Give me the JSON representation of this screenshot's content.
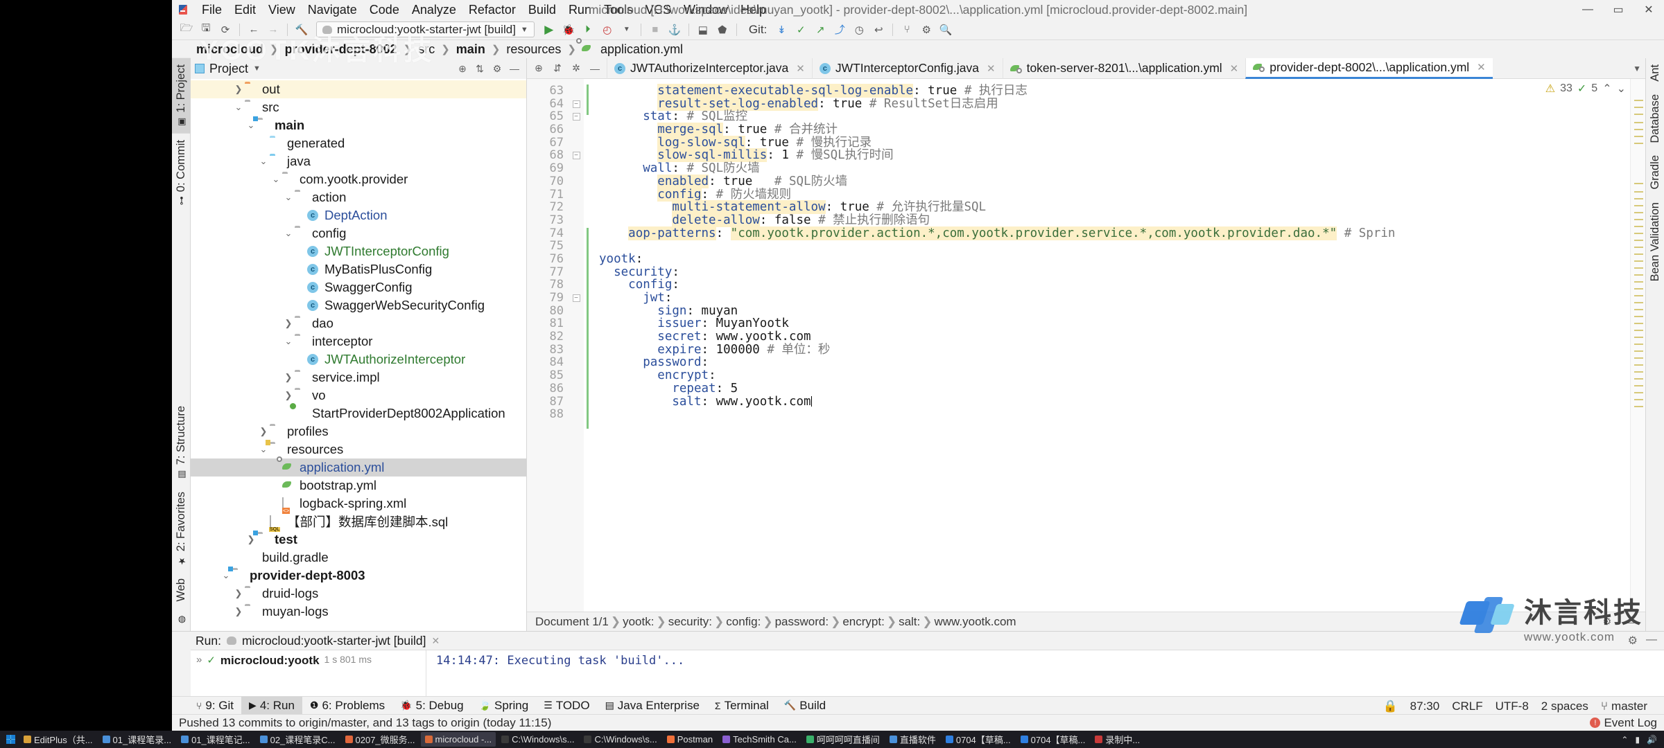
{
  "window": {
    "title": "microcloud [H:\\workspace\\idea\\muyan_yootk] - provider-dept-8002\\...\\application.yml [microcloud.provider-dept-8002.main]",
    "minimize": "—",
    "maximize": "▭",
    "close": "✕"
  },
  "menu": [
    "File",
    "Edit",
    "View",
    "Navigate",
    "Code",
    "Analyze",
    "Refactor",
    "Build",
    "Run",
    "Tools",
    "VCS",
    "Window",
    "Help"
  ],
  "toolbar": {
    "run_config": "microcloud:yootk-starter-jwt [build]",
    "git_label": "Git:",
    "icons": [
      "open-folder-icon",
      "save-icon",
      "sync-icon",
      "back-arrow-icon",
      "forward-arrow-icon",
      "build-hammer-icon",
      "run-icon",
      "debug-icon",
      "run-coverage-icon",
      "profile-icon",
      "stop-icon",
      "settings-icon",
      "search-everywhere-icon"
    ]
  },
  "navbar": {
    "crumbs": [
      "microcloud",
      "provider-dept-8002",
      "src",
      "main",
      "resources",
      "application.yml"
    ]
  },
  "left_stripe": [
    {
      "label": "1: Project",
      "active": true
    },
    {
      "label": "0: Commit",
      "active": false
    }
  ],
  "left_stripe_bottom": [
    {
      "label": "7: Structure"
    },
    {
      "label": "2: Favorites"
    },
    {
      "label": "Web"
    }
  ],
  "right_stripe": [
    {
      "label": "Ant"
    },
    {
      "label": "Database"
    },
    {
      "label": "Gradle"
    },
    {
      "label": "Bean Validation"
    }
  ],
  "project": {
    "panel_title": "Project",
    "tree": [
      {
        "depth": 3,
        "arrow": "collapsed",
        "icon": "folder-orange",
        "label": "out",
        "style": "",
        "row": "hl"
      },
      {
        "depth": 3,
        "arrow": "expanded",
        "icon": "folder-gray",
        "label": "src",
        "style": ""
      },
      {
        "depth": 4,
        "arrow": "expanded",
        "icon": "folder-module",
        "label": "main",
        "style": "bold"
      },
      {
        "depth": 5,
        "arrow": "none",
        "icon": "folder-generated",
        "label": "generated",
        "style": ""
      },
      {
        "depth": 5,
        "arrow": "expanded",
        "icon": "folder-blue",
        "label": "java",
        "style": ""
      },
      {
        "depth": 6,
        "arrow": "expanded",
        "icon": "package",
        "label": "com.yootk.provider",
        "style": ""
      },
      {
        "depth": 7,
        "arrow": "expanded",
        "icon": "package",
        "label": "action",
        "style": ""
      },
      {
        "depth": 8,
        "arrow": "none",
        "icon": "class",
        "label": "DeptAction",
        "style": "link"
      },
      {
        "depth": 7,
        "arrow": "expanded",
        "icon": "package",
        "label": "config",
        "style": ""
      },
      {
        "depth": 8,
        "arrow": "none",
        "icon": "class",
        "label": "JWTInterceptorConfig",
        "style": "green"
      },
      {
        "depth": 8,
        "arrow": "none",
        "icon": "class",
        "label": "MyBatisPlusConfig",
        "style": ""
      },
      {
        "depth": 8,
        "arrow": "none",
        "icon": "class",
        "label": "SwaggerConfig",
        "style": ""
      },
      {
        "depth": 8,
        "arrow": "none",
        "icon": "class",
        "label": "SwaggerWebSecurityConfig",
        "style": ""
      },
      {
        "depth": 7,
        "arrow": "collapsed",
        "icon": "package",
        "label": "dao",
        "style": ""
      },
      {
        "depth": 7,
        "arrow": "expanded",
        "icon": "package",
        "label": "interceptor",
        "style": ""
      },
      {
        "depth": 8,
        "arrow": "none",
        "icon": "class",
        "label": "JWTAuthorizeInterceptor",
        "style": "green"
      },
      {
        "depth": 7,
        "arrow": "collapsed",
        "icon": "package",
        "label": "service.impl",
        "style": ""
      },
      {
        "depth": 7,
        "arrow": "collapsed",
        "icon": "package",
        "label": "vo",
        "style": ""
      },
      {
        "depth": 7,
        "arrow": "none",
        "icon": "spring-class",
        "label": "StartProviderDept8002Application",
        "style": ""
      },
      {
        "depth": 5,
        "arrow": "collapsed",
        "icon": "folder-gray",
        "label": "profiles",
        "style": ""
      },
      {
        "depth": 5,
        "arrow": "expanded",
        "icon": "folder-resources",
        "label": "resources",
        "style": ""
      },
      {
        "depth": 6,
        "arrow": "none",
        "icon": "yaml",
        "label": "application.yml",
        "style": "link",
        "row": "sel"
      },
      {
        "depth": 6,
        "arrow": "none",
        "icon": "yaml-plain",
        "label": "bootstrap.yml",
        "style": ""
      },
      {
        "depth": 6,
        "arrow": "none",
        "icon": "xml",
        "label": "logback-spring.xml",
        "style": ""
      },
      {
        "depth": 5,
        "arrow": "none",
        "icon": "sql",
        "label": "【部门】数据库创建脚本.sql",
        "style": ""
      },
      {
        "depth": 4,
        "arrow": "collapsed",
        "icon": "folder-module",
        "label": "test",
        "style": "bold"
      },
      {
        "depth": 3,
        "arrow": "none",
        "icon": "gradle",
        "label": "build.gradle",
        "style": ""
      },
      {
        "depth": 2,
        "arrow": "expanded",
        "icon": "folder-module",
        "label": "provider-dept-8003",
        "style": "bold"
      },
      {
        "depth": 3,
        "arrow": "collapsed",
        "icon": "folder-gray",
        "label": "druid-logs",
        "style": ""
      },
      {
        "depth": 3,
        "arrow": "collapsed",
        "icon": "folder-gray",
        "label": "muyan-logs",
        "style": ""
      }
    ]
  },
  "editor": {
    "tabs": [
      {
        "label": "JWTAuthorizeInterceptor.java",
        "icon": "class-icon",
        "active": false
      },
      {
        "label": "JWTInterceptorConfig.java",
        "icon": "class-icon",
        "active": false
      },
      {
        "label": "token-server-8201\\...\\application.yml",
        "icon": "yaml-icon",
        "active": false
      },
      {
        "label": "provider-dept-8002\\...\\application.yml",
        "icon": "yaml-icon",
        "active": true
      }
    ],
    "inspection": {
      "warnings": "33",
      "checks": "5",
      "warn_icon": "warning-triangle-icon",
      "ok_icon": "check-icon"
    },
    "first_line_number": 63,
    "lines": [
      {
        "n": 63,
        "indent": 8,
        "tokens": [
          {
            "t": "statement-executable-sql-log-enable",
            "c": "k",
            "hl": true
          },
          {
            "t": ": ",
            "c": "v"
          },
          {
            "t": "true",
            "c": "v"
          },
          {
            "t": " # 执行日志",
            "c": "cm"
          }
        ]
      },
      {
        "n": 64,
        "indent": 8,
        "fold": "minus",
        "tokens": [
          {
            "t": "result-set-log-enabled",
            "c": "k",
            "hl": true
          },
          {
            "t": ": ",
            "c": "v"
          },
          {
            "t": "true",
            "c": "v"
          },
          {
            "t": " # ResultSet日志启用",
            "c": "cm"
          }
        ]
      },
      {
        "n": 65,
        "indent": 6,
        "fold": "minus",
        "tokens": [
          {
            "t": "stat",
            "c": "k"
          },
          {
            "t": ": ",
            "c": "v"
          },
          {
            "t": "# SQL监控",
            "c": "cm"
          }
        ]
      },
      {
        "n": 66,
        "indent": 8,
        "tokens": [
          {
            "t": "merge-sql",
            "c": "k",
            "hl": true
          },
          {
            "t": ": ",
            "c": "v"
          },
          {
            "t": "true",
            "c": "v"
          },
          {
            "t": " # 合并统计",
            "c": "cm"
          }
        ]
      },
      {
        "n": 67,
        "indent": 8,
        "tokens": [
          {
            "t": "log-slow-sql",
            "c": "k",
            "hl": true
          },
          {
            "t": ": ",
            "c": "v"
          },
          {
            "t": "true",
            "c": "v"
          },
          {
            "t": " # 慢执行记录",
            "c": "cm"
          }
        ]
      },
      {
        "n": 68,
        "indent": 8,
        "fold": "minus",
        "tokens": [
          {
            "t": "slow-sql-millis",
            "c": "k",
            "hl": true
          },
          {
            "t": ": ",
            "c": "v"
          },
          {
            "t": "1",
            "c": "v"
          },
          {
            "t": " # 慢SQL执行时间",
            "c": "cm"
          }
        ]
      },
      {
        "n": 69,
        "indent": 6,
        "tokens": [
          {
            "t": "wall",
            "c": "k"
          },
          {
            "t": ": ",
            "c": "v"
          },
          {
            "t": "# SQL防火墙",
            "c": "cm"
          }
        ]
      },
      {
        "n": 70,
        "indent": 8,
        "tokens": [
          {
            "t": "enabled",
            "c": "k",
            "hl": true
          },
          {
            "t": ": ",
            "c": "v"
          },
          {
            "t": "true",
            "c": "v"
          },
          {
            "t": "   # SQL防火墙",
            "c": "cm"
          }
        ]
      },
      {
        "n": 71,
        "indent": 8,
        "tokens": [
          {
            "t": "config",
            "c": "k",
            "hl": true
          },
          {
            "t": ": ",
            "c": "v"
          },
          {
            "t": "# 防火墙规则",
            "c": "cm"
          }
        ]
      },
      {
        "n": 72,
        "indent": 10,
        "tokens": [
          {
            "t": "multi-statement-allow",
            "c": "k",
            "hl": true
          },
          {
            "t": ": ",
            "c": "v"
          },
          {
            "t": "true",
            "c": "v"
          },
          {
            "t": " # 允许执行批量SQL",
            "c": "cm"
          }
        ]
      },
      {
        "n": 73,
        "indent": 10,
        "tokens": [
          {
            "t": "delete-allow",
            "c": "k",
            "hl": true
          },
          {
            "t": ": ",
            "c": "v"
          },
          {
            "t": "false",
            "c": "v"
          },
          {
            "t": " # 禁止执行删除语句",
            "c": "cm"
          }
        ]
      },
      {
        "n": 74,
        "indent": 4,
        "tokens": [
          {
            "t": "aop-patterns",
            "c": "k",
            "hl": true
          },
          {
            "t": ": ",
            "c": "v"
          },
          {
            "t": "\"com.yootk.provider.action.*,com.yootk.provider.service.*,com.yootk.provider.dao.*\"",
            "c": "str",
            "hl": true
          },
          {
            "t": " # Sprin",
            "c": "cm"
          }
        ]
      },
      {
        "n": 75,
        "indent": 0,
        "tokens": []
      },
      {
        "n": 76,
        "indent": 0,
        "tokens": [
          {
            "t": "yootk",
            "c": "k"
          },
          {
            "t": ":",
            "c": "v"
          }
        ]
      },
      {
        "n": 77,
        "indent": 2,
        "tokens": [
          {
            "t": "security",
            "c": "k"
          },
          {
            "t": ":",
            "c": "v"
          }
        ]
      },
      {
        "n": 78,
        "indent": 4,
        "tokens": [
          {
            "t": "config",
            "c": "k"
          },
          {
            "t": ":",
            "c": "v"
          }
        ]
      },
      {
        "n": 79,
        "indent": 6,
        "fold": "minus",
        "tokens": [
          {
            "t": "jwt",
            "c": "k"
          },
          {
            "t": ":",
            "c": "v"
          }
        ]
      },
      {
        "n": 80,
        "indent": 8,
        "tokens": [
          {
            "t": "sign",
            "c": "k"
          },
          {
            "t": ": ",
            "c": "v"
          },
          {
            "t": "muyan",
            "c": "v"
          }
        ]
      },
      {
        "n": 81,
        "indent": 8,
        "tokens": [
          {
            "t": "issuer",
            "c": "k"
          },
          {
            "t": ": ",
            "c": "v"
          },
          {
            "t": "MuyanYootk",
            "c": "v"
          }
        ]
      },
      {
        "n": 82,
        "indent": 8,
        "tokens": [
          {
            "t": "secret",
            "c": "k"
          },
          {
            "t": ": ",
            "c": "v"
          },
          {
            "t": "www.yootk.com",
            "c": "v"
          }
        ]
      },
      {
        "n": 83,
        "indent": 8,
        "tokens": [
          {
            "t": "expire",
            "c": "k"
          },
          {
            "t": ": ",
            "c": "v"
          },
          {
            "t": "100000",
            "c": "v"
          },
          {
            "t": " # 单位：秒",
            "c": "cm"
          }
        ]
      },
      {
        "n": 84,
        "indent": 6,
        "tokens": [
          {
            "t": "password",
            "c": "k"
          },
          {
            "t": ":",
            "c": "v"
          }
        ]
      },
      {
        "n": 85,
        "indent": 8,
        "tokens": [
          {
            "t": "encrypt",
            "c": "k"
          },
          {
            "t": ":",
            "c": "v"
          }
        ]
      },
      {
        "n": 86,
        "indent": 10,
        "tokens": [
          {
            "t": "repeat",
            "c": "k"
          },
          {
            "t": ": ",
            "c": "v"
          },
          {
            "t": "5",
            "c": "v"
          }
        ]
      },
      {
        "n": 87,
        "indent": 10,
        "caret": true,
        "tokens": [
          {
            "t": "salt",
            "c": "k"
          },
          {
            "t": ": ",
            "c": "v"
          },
          {
            "t": "www.yootk.com",
            "c": "v"
          }
        ]
      },
      {
        "n": 88,
        "indent": 0,
        "tokens": []
      }
    ],
    "doc_breadcrumb": [
      "Document 1/1",
      "yootk:",
      "security:",
      "config:",
      "password:",
      "encrypt:",
      "salt:",
      "www.yootk.com"
    ]
  },
  "run_window": {
    "label": "Run:",
    "config_name": "microcloud:yootk-starter-jwt [build]",
    "close": "✕",
    "task_name": "microcloud:yootk",
    "task_time": "1 s 801 ms",
    "check": "✓",
    "output": "14:14:47: Executing task 'build'..."
  },
  "tool_tabs": [
    {
      "label": "9: Git",
      "icon": "git-icon",
      "active": false
    },
    {
      "label": "4: Run",
      "icon": "run-icon",
      "active": true
    },
    {
      "label": "6: Problems",
      "icon": "problems-icon",
      "active": false
    },
    {
      "label": "5: Debug",
      "icon": "debug-icon",
      "active": false
    },
    {
      "label": "Spring",
      "icon": "spring-leaf-icon",
      "active": false
    },
    {
      "label": "TODO",
      "icon": "todo-list-icon",
      "active": false
    },
    {
      "label": "Java Enterprise",
      "icon": "java-ee-icon",
      "active": false
    },
    {
      "label": "Terminal",
      "icon": "terminal-icon",
      "active": false
    },
    {
      "label": "Build",
      "icon": "build-hammer-icon",
      "active": false
    }
  ],
  "status_bar": {
    "message": "Pushed 13 commits to origin/master, and 13 tags to origin (today 11:15)",
    "event_log": "Event Log",
    "caret": "87:30",
    "line_sep": "CRLF",
    "encoding": "UTF-8",
    "indent": "2 spaces",
    "branch": "master",
    "lock_icon": "lock-icon",
    "branch_icon": "branch-icon"
  },
  "taskbar": {
    "items": [
      {
        "label": "EditPlus（共...",
        "color": "#d8a13a"
      },
      {
        "label": "01_课程笔录...",
        "color": "#4a90d9"
      },
      {
        "label": "01_课程笔记...",
        "color": "#4a90d9"
      },
      {
        "label": "02_课程笔录C...",
        "color": "#4a90d9"
      },
      {
        "label": "0207_微服务...",
        "color": "#e0663c"
      },
      {
        "label": "microcloud -...",
        "color": "#d86a3a",
        "active": true
      },
      {
        "label": "C:\\Windows\\s...",
        "color": "#3a3a3a"
      },
      {
        "label": "C:\\Windows\\s...",
        "color": "#3a3a3a"
      },
      {
        "label": "Postman",
        "color": "#f0703a"
      },
      {
        "label": "TechSmith Ca...",
        "color": "#8a5fd0"
      },
      {
        "label": "呵呵呵呵直播间",
        "color": "#3ab06a"
      },
      {
        "label": "直播软件",
        "color": "#4a90d9"
      },
      {
        "label": "0704【草稿...",
        "color": "#2f7fe0"
      },
      {
        "label": "0704【草稿...",
        "color": "#2f7fe0"
      },
      {
        "label": "录制中...",
        "color": "#c83a3a"
      }
    ],
    "clock": ""
  },
  "watermark": {
    "brand": "沐言科技",
    "url": "www.yootk.com",
    "faint": "YOOTK沐言科技"
  }
}
